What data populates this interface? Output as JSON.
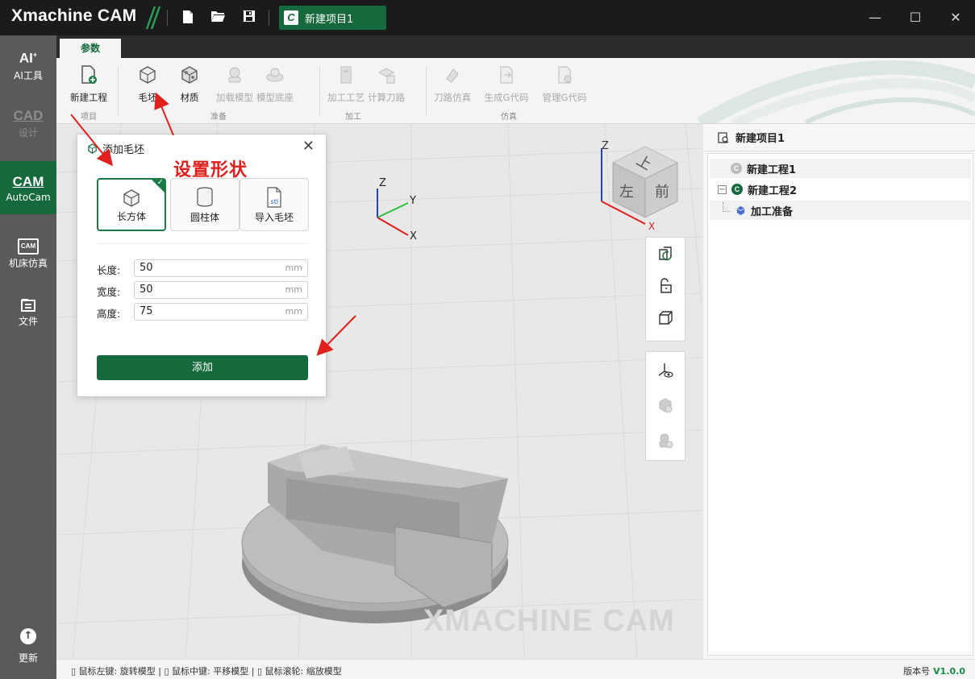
{
  "titlebar": {
    "app_name": "Xmachine CAM",
    "project_tab_icon": "C",
    "project_tab_label": "新建项目1",
    "icons": [
      "new-file-icon",
      "open-folder-icon",
      "save-icon"
    ],
    "window_controls": [
      "minimize-icon",
      "maximize-icon",
      "close-icon"
    ]
  },
  "sidebar": {
    "items": [
      {
        "icon": "AI",
        "label": "AI工具",
        "state": "normal"
      },
      {
        "icon": "CAD",
        "label": "设计",
        "state": "disabled"
      },
      {
        "icon": "CAM",
        "label": "AutoCam",
        "state": "active"
      },
      {
        "icon": "CAM",
        "label": "机床仿真",
        "state": "normal"
      },
      {
        "icon": "file-icon",
        "label": "文件",
        "state": "normal"
      }
    ],
    "update_label": "更新"
  },
  "ribbon": {
    "active_tab": "参数",
    "buttons": [
      {
        "label": "新建工程",
        "enabled": true
      },
      {
        "label": "毛坯",
        "enabled": true
      },
      {
        "label": "材质",
        "enabled": true
      },
      {
        "label": "加载模型",
        "enabled": false
      },
      {
        "label": "模型底座",
        "enabled": false
      },
      {
        "label": "加工工艺",
        "enabled": false
      },
      {
        "label": "计算刀路",
        "enabled": false
      },
      {
        "label": "刀路仿真",
        "enabled": false
      },
      {
        "label": "生成G代码",
        "enabled": false
      },
      {
        "label": "管理G代码",
        "enabled": false
      }
    ],
    "groups": [
      "项目",
      "准备",
      "加工",
      "仿真"
    ]
  },
  "dialog": {
    "title": "添加毛坯",
    "shapes": [
      {
        "label": "长方体",
        "selected": true
      },
      {
        "label": "圆柱体",
        "selected": false
      },
      {
        "label": "导入毛坯",
        "selected": false,
        "badge": ".stl"
      }
    ],
    "fields": [
      {
        "label": "长度:",
        "value": "50",
        "unit": "mm"
      },
      {
        "label": "宽度:",
        "value": "50",
        "unit": "mm"
      },
      {
        "label": "高度:",
        "value": "75",
        "unit": "mm"
      }
    ],
    "submit_label": "添加"
  },
  "annotation": {
    "text": "设置形状",
    "color": "#e0201c"
  },
  "viewport": {
    "axis_labels": {
      "z": "Z",
      "y": "Y",
      "x": "X"
    },
    "viewcube": {
      "top": "上",
      "left": "左",
      "front": "前",
      "z": "Z",
      "x": "X"
    },
    "watermark": "XMACHINE CAM",
    "toolbar_icons": [
      "rotate-view-icon",
      "unlock-icon",
      "box-view-icon",
      "axis-view-icon",
      "hide-model-icon",
      "hide-part-icon"
    ]
  },
  "project_panel": {
    "title": "新建项目1",
    "tree": [
      {
        "label": "新建工程1",
        "level": 0,
        "active": false,
        "icon": "C"
      },
      {
        "label": "新建工程2",
        "level": 0,
        "active": true,
        "expanded": true,
        "icon": "C"
      },
      {
        "label": "加工准备",
        "level": 1,
        "active": false,
        "icon": "cube-icon"
      }
    ]
  },
  "statusbar": {
    "hints": [
      {
        "key": "鼠标左键:",
        "action": "旋转模型"
      },
      {
        "key": "鼠标中键:",
        "action": "平移模型"
      },
      {
        "key": "鼠标滚轮:",
        "action": "缩放模型"
      }
    ],
    "version_label": "版本号",
    "version_value": "V1.0.0"
  },
  "colors": {
    "brand_green": "#16693c",
    "titlebar": "#1b1b1b",
    "sidebar": "#5a5a5a",
    "annotation_red": "#e0201c"
  }
}
